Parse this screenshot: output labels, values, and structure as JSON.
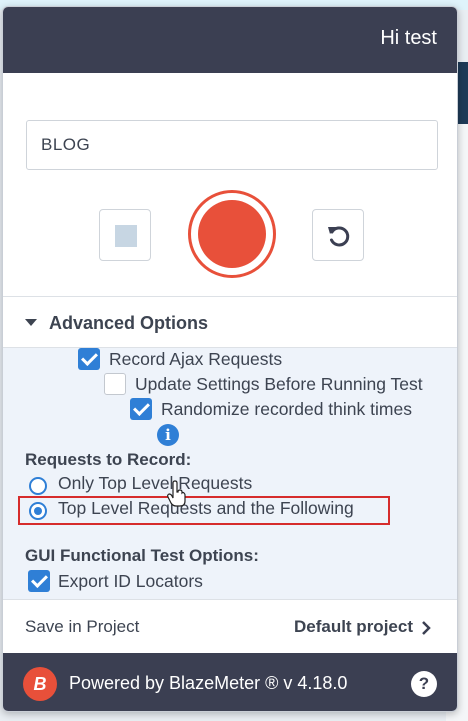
{
  "header": {
    "greeting": "Hi test"
  },
  "test_name": {
    "value": "BLOG"
  },
  "advanced": {
    "title": "Advanced Options",
    "options": [
      {
        "label": "Record Ajax Requests",
        "checked": true
      },
      {
        "label": "Update Settings Before Running Test",
        "checked": false
      },
      {
        "label": "Randomize recorded think times",
        "checked": true
      }
    ],
    "info_icon": "info-icon",
    "requests_heading": "Requests to Record:",
    "radios": [
      {
        "label": "Only Top Level Requests",
        "selected": false
      },
      {
        "label": "Top Level Requests and the Following",
        "selected": true
      }
    ],
    "gui_heading": "GUI Functional Test Options:",
    "gui_options": [
      {
        "label": "Export ID Locators",
        "checked": true
      }
    ]
  },
  "project": {
    "label": "Save in Project",
    "value": "Default project"
  },
  "footer": {
    "powered": "Powered by BlazeMeter ® v 4.18.0",
    "logo_letter": "B",
    "help": "?"
  },
  "colors": {
    "accent": "#2f7fd6",
    "record": "#e8503a",
    "header_bg": "#3b3f52",
    "highlight": "#d62c2c"
  }
}
